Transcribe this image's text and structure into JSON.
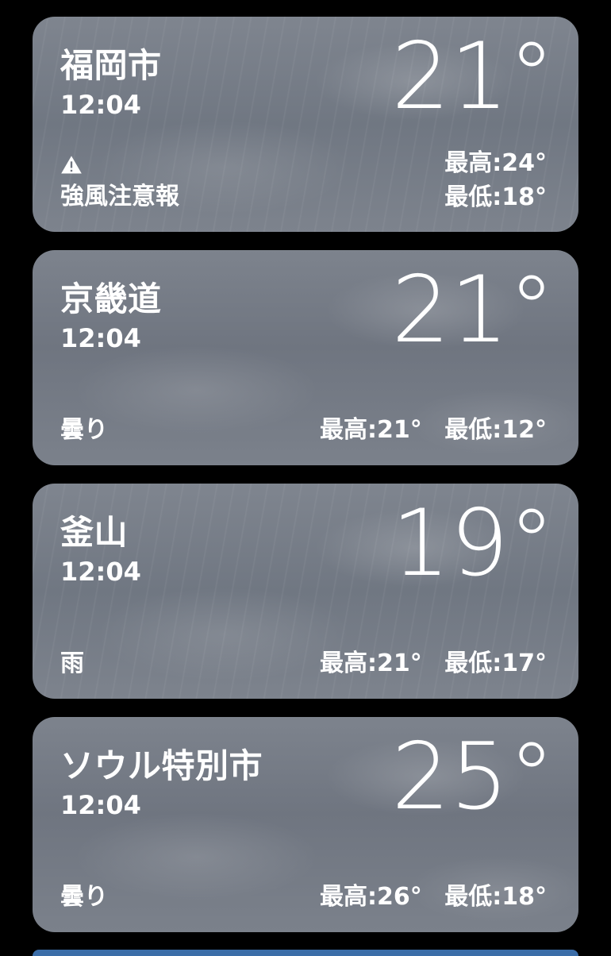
{
  "cards": [
    {
      "city": "福岡市",
      "time": "12:04",
      "temp": "21°",
      "alert": "強風注意報",
      "high": "最高:24°",
      "low": "最低:18°",
      "icon": "warning-triangle-icon",
      "style": "rainy"
    },
    {
      "city": "京畿道",
      "time": "12:04",
      "temp": "21°",
      "condition": "曇り",
      "high": "最高:21°",
      "low": "最低:12°",
      "style": "cloudy"
    },
    {
      "city": "釜山",
      "time": "12:04",
      "temp": "19°",
      "condition": "雨",
      "high": "最高:21°",
      "low": "最低:17°",
      "style": "rainy"
    },
    {
      "city": "ソウル特別市",
      "time": "12:04",
      "temp": "25°",
      "condition": "曇り",
      "high": "最高:26°",
      "low": "最低:18°",
      "style": "cloudy"
    }
  ]
}
